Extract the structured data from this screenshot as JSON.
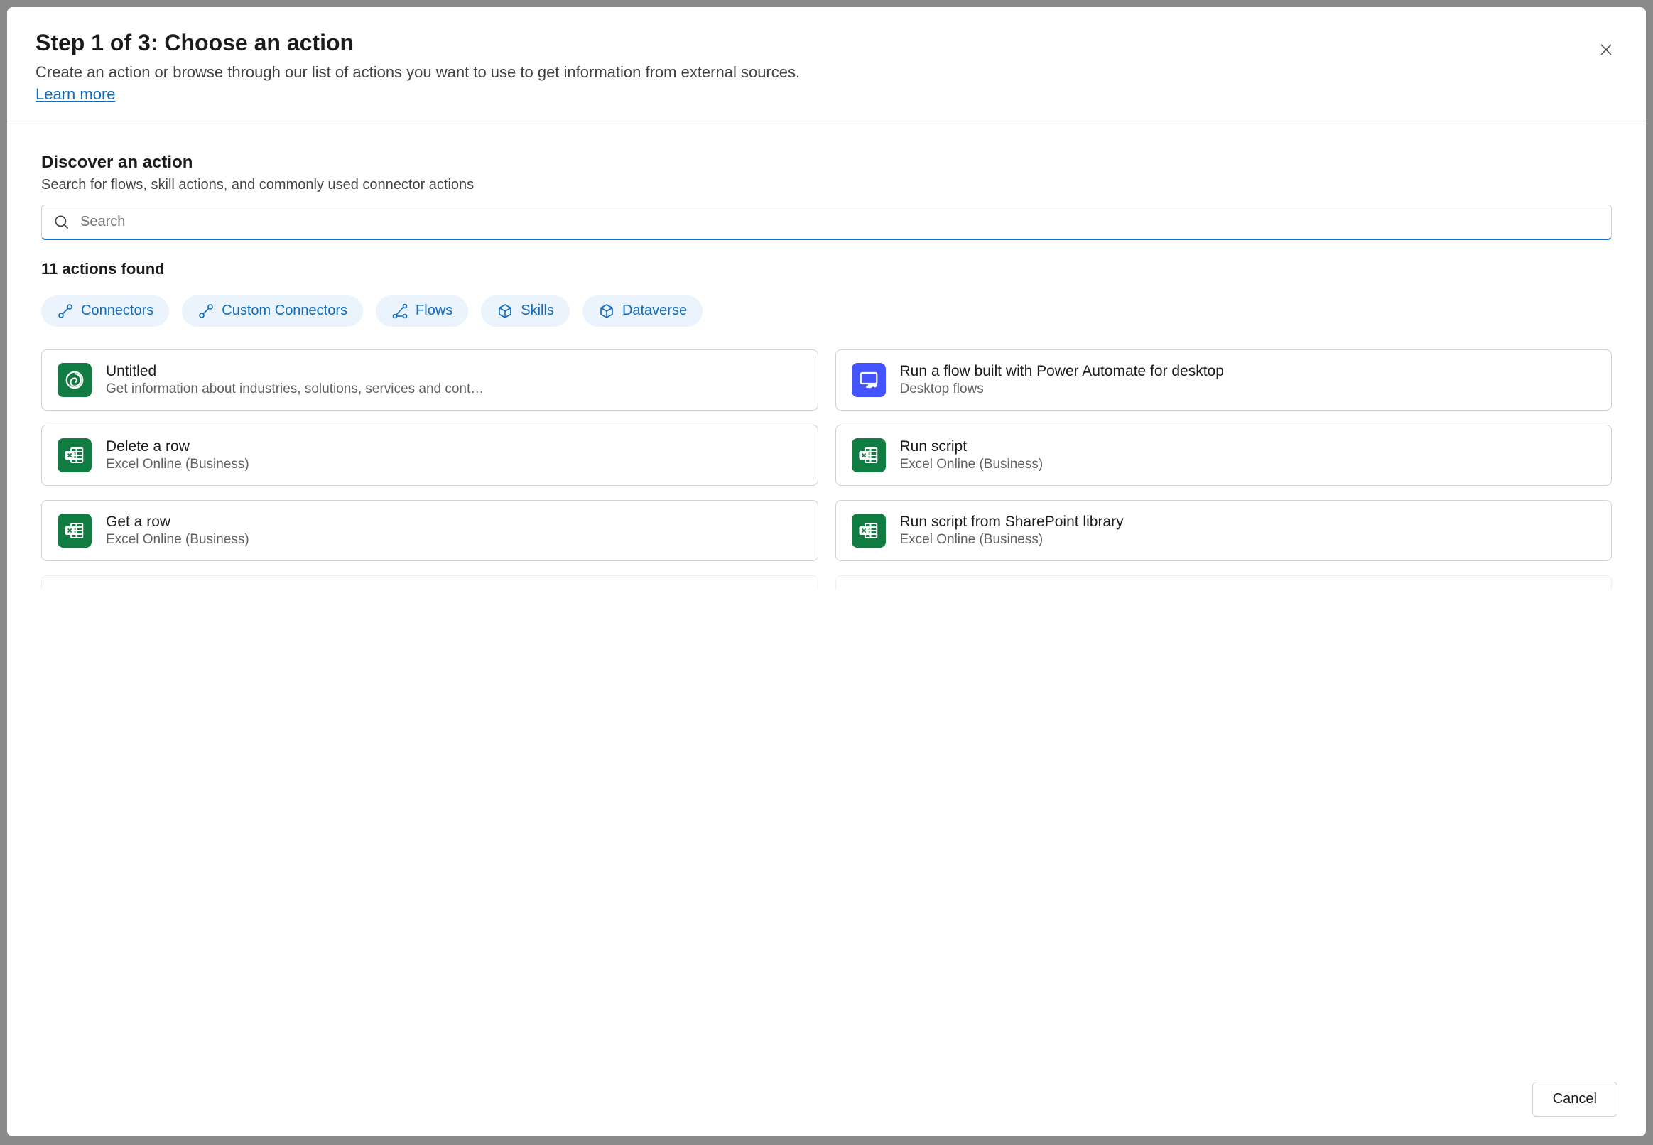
{
  "header": {
    "title": "Step 1 of 3: Choose an action",
    "description": "Create an action or browse through our list of actions you want to use to get information from external sources.",
    "learn_more": "Learn more"
  },
  "discover": {
    "title": "Discover an action",
    "subtitle": "Search for flows, skill actions, and commonly used connector actions",
    "search_placeholder": "Search"
  },
  "results_count": "11 actions found",
  "filters": [
    {
      "label": "Connectors",
      "icon": "connector"
    },
    {
      "label": "Custom Connectors",
      "icon": "connector"
    },
    {
      "label": "Flows",
      "icon": "flow"
    },
    {
      "label": "Skills",
      "icon": "cube"
    },
    {
      "label": "Dataverse",
      "icon": "cube"
    }
  ],
  "actions": [
    {
      "title": "Untitled",
      "subtitle": "Get information about industries, solutions, services and cont…",
      "icon": "swirl",
      "color": "green"
    },
    {
      "title": "Run a flow built with Power Automate for desktop",
      "subtitle": "Desktop flows",
      "icon": "desktop-flow",
      "color": "blue"
    },
    {
      "title": "Delete a row",
      "subtitle": "Excel Online (Business)",
      "icon": "excel",
      "color": "green"
    },
    {
      "title": "Run script",
      "subtitle": "Excel Online (Business)",
      "icon": "excel",
      "color": "green"
    },
    {
      "title": "Get a row",
      "subtitle": "Excel Online (Business)",
      "icon": "excel",
      "color": "green"
    },
    {
      "title": "Run script from SharePoint library",
      "subtitle": "Excel Online (Business)",
      "icon": "excel",
      "color": "green"
    }
  ],
  "footer": {
    "cancel": "Cancel"
  }
}
